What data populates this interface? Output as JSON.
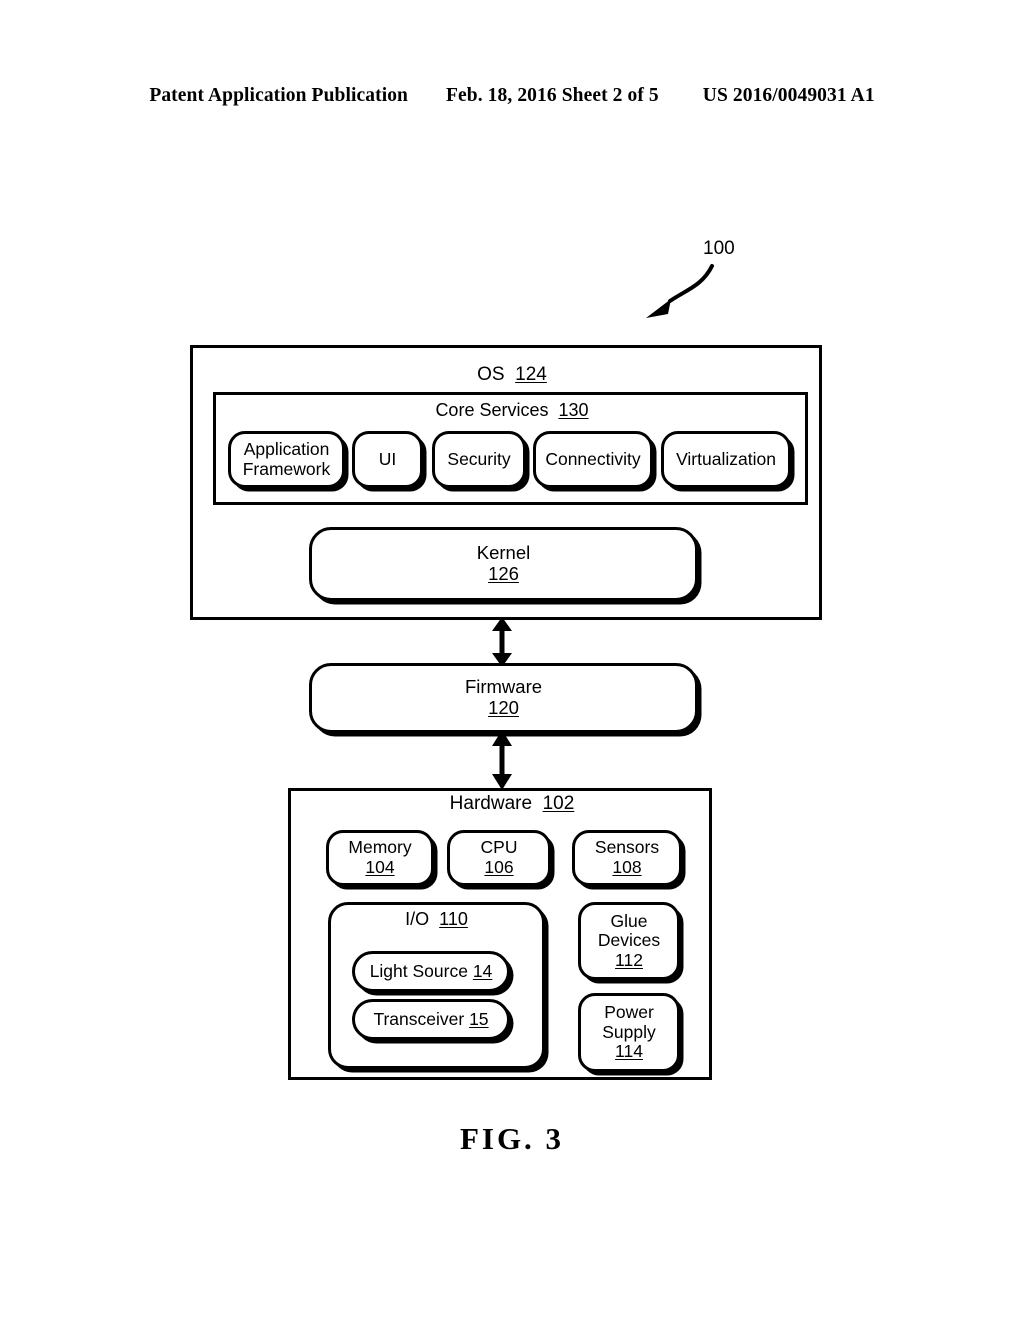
{
  "header": {
    "left": "Patent Application Publication",
    "middle": "Feb. 18, 2016  Sheet 2 of 5",
    "right": "US 2016/0049031 A1"
  },
  "figure": {
    "caption": "FIG. 3",
    "reference_numeral": "100"
  },
  "os": {
    "title_text": "OS",
    "title_num": "124",
    "core_services": {
      "title_text": "Core Services",
      "title_num": "130",
      "items": [
        {
          "label": "Application\nFramework",
          "line1": "Application",
          "line2": "Framework"
        },
        {
          "label": "UI",
          "line1": "UI",
          "line2": ""
        },
        {
          "label": "Security",
          "line1": "Security",
          "line2": ""
        },
        {
          "label": "Connectivity",
          "line1": "Connectivity",
          "line2": ""
        },
        {
          "label": "Virtualization",
          "line1": "Virtualization",
          "line2": ""
        }
      ]
    },
    "kernel": {
      "label": "Kernel",
      "num": "126"
    }
  },
  "firmware": {
    "label": "Firmware",
    "num": "120"
  },
  "hardware": {
    "title_text": "Hardware",
    "title_num": "102",
    "memory": {
      "label": "Memory",
      "num": "104"
    },
    "cpu": {
      "label": "CPU",
      "num": "106"
    },
    "sensors": {
      "label": "Sensors",
      "num": "108"
    },
    "io": {
      "title_text": "I/O",
      "title_num": "110",
      "light_source": {
        "label": "Light Source",
        "num": "14"
      },
      "transceiver": {
        "label": "Transceiver",
        "num": "15"
      }
    },
    "glue_devices": {
      "line1": "Glue",
      "line2": "Devices",
      "num": "112"
    },
    "power_supply": {
      "line1": "Power",
      "line2": "Supply",
      "num": "114"
    }
  },
  "colors": {
    "ink": "#000000",
    "page": "#ffffff"
  }
}
